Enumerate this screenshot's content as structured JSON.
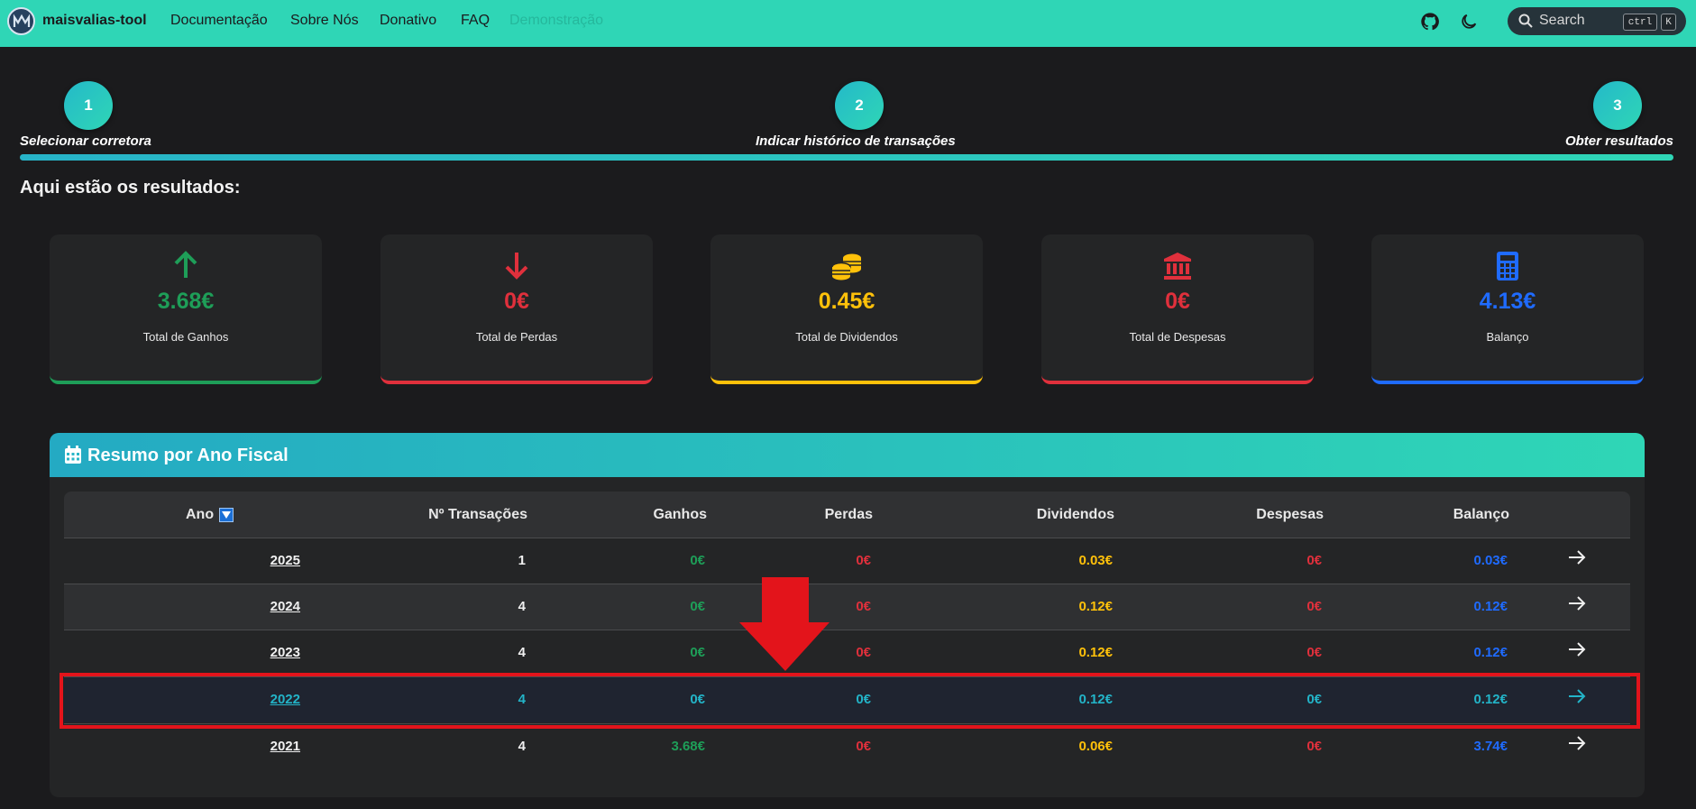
{
  "nav": {
    "brand": "maisvalias-tool",
    "links": [
      "Documentação",
      "Sobre Nós",
      "Donativo",
      "FAQ",
      "Demonstração"
    ],
    "search_placeholder": "Search",
    "kbd_ctrl": "ctrl",
    "kbd_k": "K",
    "icons": [
      "github-icon",
      "moon-icon",
      "search-icon"
    ]
  },
  "stepper": {
    "steps": [
      {
        "number": "1",
        "label": "Selecionar corretora"
      },
      {
        "number": "2",
        "label": "Indicar histórico de transações"
      },
      {
        "number": "3",
        "label": "Obter resultados"
      }
    ],
    "progress_fraction": 1.0
  },
  "results_title": "Aqui estão os resultados:",
  "cards": [
    {
      "value": "3.68€",
      "label": "Total de Ganhos",
      "icon": "arrow-up-icon",
      "color": "#1e9e58"
    },
    {
      "value": "0€",
      "label": "Total de Perdas",
      "icon": "arrow-down-icon",
      "color": "#e0303c"
    },
    {
      "value": "0.45€",
      "label": "Total de Dividendos",
      "icon": "coins-icon",
      "color": "#ffc10a"
    },
    {
      "value": "0€",
      "label": "Total de Despesas",
      "icon": "bank-icon",
      "color": "#e0303c"
    },
    {
      "value": "4.13€",
      "label": "Balanço",
      "icon": "calculator-icon",
      "color": "#1f6bff"
    }
  ],
  "fiscal": {
    "title": "Resumo por Ano Fiscal",
    "columns": [
      "Ano",
      "Nº Transações",
      "Ganhos",
      "Perdas",
      "Dividendos",
      "Despesas",
      "Balanço"
    ],
    "rows": [
      {
        "year": "2025",
        "transactions": "1",
        "gains": "0€",
        "losses": "0€",
        "dividends": "0.03€",
        "expenses": "0€",
        "balance": "0.03€"
      },
      {
        "year": "2024",
        "transactions": "4",
        "gains": "0€",
        "losses": "0€",
        "dividends": "0.12€",
        "expenses": "0€",
        "balance": "0.12€"
      },
      {
        "year": "2023",
        "transactions": "4",
        "gains": "0€",
        "losses": "0€",
        "dividends": "0.12€",
        "expenses": "0€",
        "balance": "0.12€"
      },
      {
        "year": "2022",
        "transactions": "4",
        "gains": "0€",
        "losses": "0€",
        "dividends": "0.12€",
        "expenses": "0€",
        "balance": "0.12€"
      },
      {
        "year": "2021",
        "transactions": "4",
        "gains": "3.68€",
        "losses": "0€",
        "dividends": "0.06€",
        "expenses": "0€",
        "balance": "3.74€"
      }
    ],
    "highlighted_year": "2022"
  },
  "colors": {
    "accent": "#2fd6b6",
    "background": "#1b1b1d",
    "highlight": "#e3141b"
  }
}
